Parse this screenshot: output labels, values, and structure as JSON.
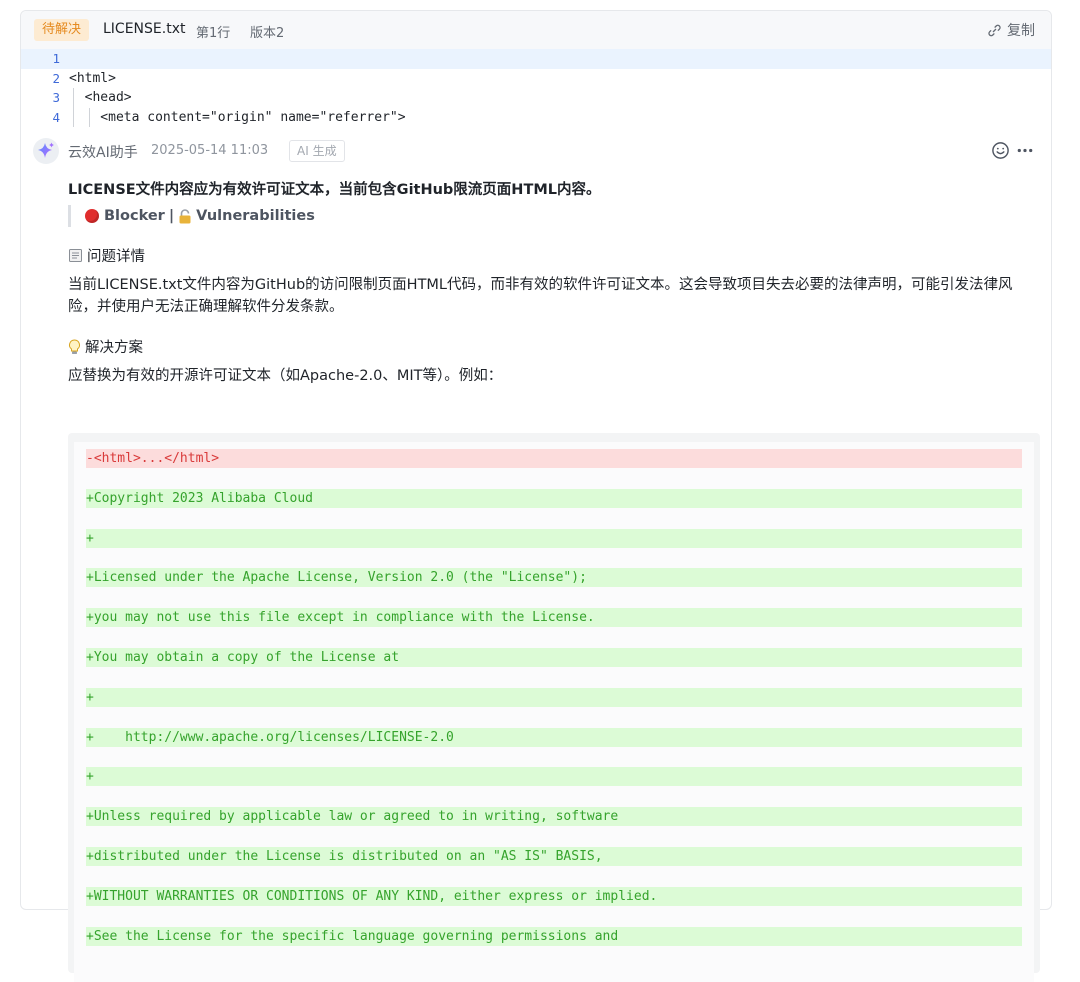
{
  "header": {
    "status": "待解决",
    "file_name": "LICENSE.txt",
    "line": "第1行",
    "version": "版本2",
    "copy_label": "复制"
  },
  "code_preview": [
    {
      "no": "1",
      "text": ""
    },
    {
      "no": "2",
      "text": "<html>"
    },
    {
      "no": "3",
      "text": "  <head>"
    },
    {
      "no": "4",
      "text": "    <meta content=\"origin\" name=\"referrer\">"
    }
  ],
  "comment": {
    "author": "云效AI助手",
    "timestamp": "2025-05-14 11:03",
    "badge": "AI 生成",
    "title": "LICENSE文件内容应为有效许可证文本，当前包含GitHub限流页面HTML内容。",
    "severity": "Blocker",
    "separator": "|",
    "category": "Vulnerabilities",
    "details_heading": "问题详情",
    "details_text": "当前LICENSE.txt文件内容为GitHub的访问限制页面HTML代码，而非有效的软件许可证文本。这会导致项目失去必要的法律声明，可能引发法律风险，并使用户无法正确理解软件分发条款。",
    "solution_heading": "解决方案",
    "solution_text": "应替换为有效的开源许可证文本（如Apache-2.0、MIT等）。例如：",
    "diff": [
      {
        "type": "del",
        "text": "-<html>...</html>"
      },
      {
        "type": "add",
        "text": "+Copyright 2023 Alibaba Cloud"
      },
      {
        "type": "add",
        "text": "+"
      },
      {
        "type": "add",
        "text": "+Licensed under the Apache License, Version 2.0 (the \"License\");"
      },
      {
        "type": "add",
        "text": "+you may not use this file except in compliance with the License."
      },
      {
        "type": "add",
        "text": "+You may obtain a copy of the License at"
      },
      {
        "type": "add",
        "text": "+"
      },
      {
        "type": "add",
        "text": "+    http://www.apache.org/licenses/LICENSE-2.0"
      },
      {
        "type": "add",
        "text": "+"
      },
      {
        "type": "add",
        "text": "+Unless required by applicable law or agreed to in writing, software"
      },
      {
        "type": "add",
        "text": "+distributed under the License is distributed on an \"AS IS\" BASIS,"
      },
      {
        "type": "add",
        "text": "+WITHOUT WARRANTIES OR CONDITIONS OF ANY KIND, either express or implied."
      },
      {
        "type": "add",
        "text": "+See the License for the specific language governing permissions and"
      }
    ]
  },
  "icons": {
    "copy": "link-icon",
    "avatar": "sparkle-icon",
    "emoji": "smiley-icon",
    "more": "more-horizontal-icon",
    "severity": "red-circle-icon",
    "category": "lock-icon",
    "details": "memo-icon",
    "solution": "lightbulb-icon"
  },
  "colors": {
    "status_bg": "#fdebd2",
    "status_text": "#e58a1f",
    "diff_del_bg": "#fcdcdc",
    "diff_del_text": "#d93a3a",
    "diff_add_bg": "#dcfbd6",
    "diff_add_text": "#35a32c",
    "active_line": "#eaf3fe"
  }
}
